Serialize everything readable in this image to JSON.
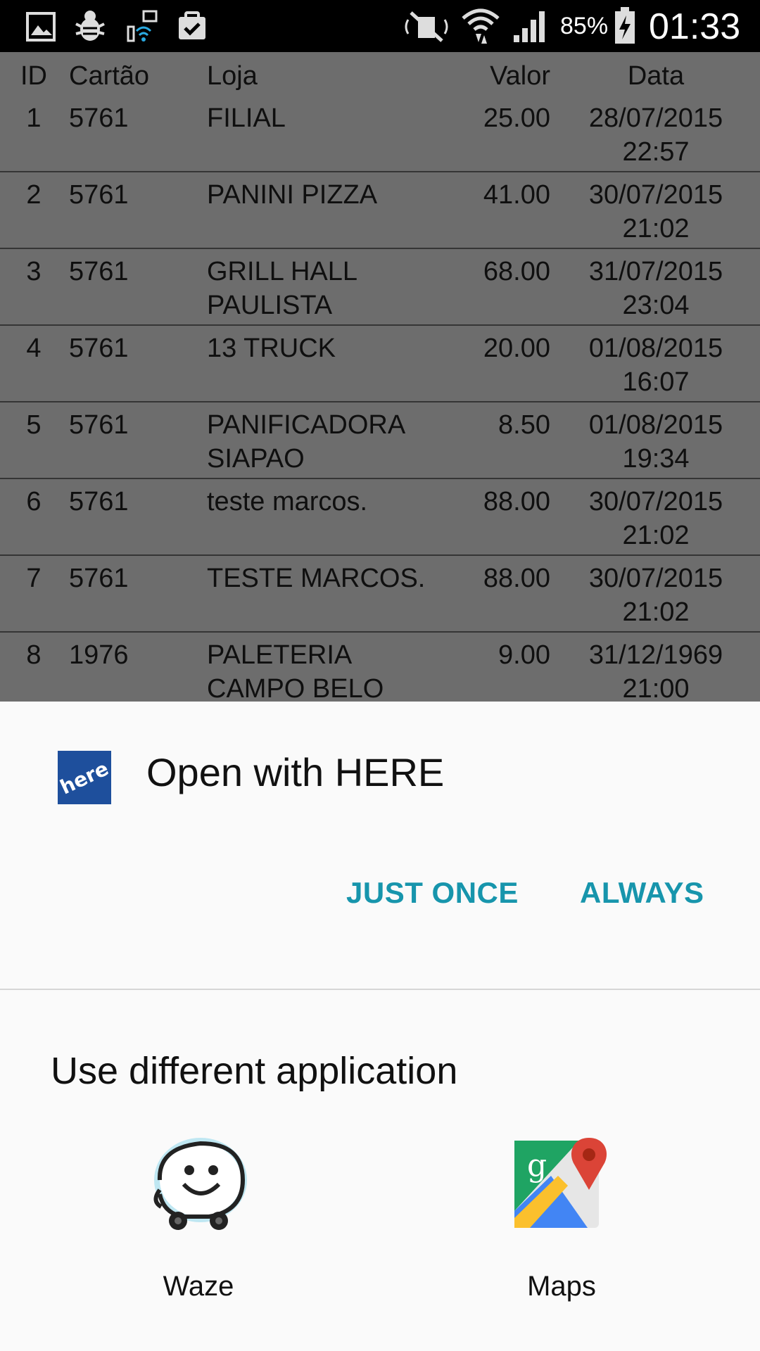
{
  "status_bar": {
    "battery": "85%",
    "clock": "01:33",
    "icons": [
      "gallery-icon",
      "debug-bug-icon",
      "wifi-transfer-icon",
      "clipboard-check-icon",
      "mute-icon",
      "wifi-icon",
      "signal-icon",
      "battery-charging-icon"
    ]
  },
  "table": {
    "headers": {
      "id": "ID",
      "card": "Cartão",
      "store": "Loja",
      "value": "Valor",
      "date": "Data"
    },
    "rows": [
      {
        "id": "1",
        "card": "5761",
        "store": "FILIAL",
        "value": "25.00",
        "date": "28/07/2015 22:57"
      },
      {
        "id": "2",
        "card": "5761",
        "store": "PANINI PIZZA",
        "value": "41.00",
        "date": "30/07/2015 21:02"
      },
      {
        "id": "3",
        "card": "5761",
        "store": "GRILL HALL PAULISTA",
        "value": "68.00",
        "date": "31/07/2015 23:04"
      },
      {
        "id": "4",
        "card": "5761",
        "store": "13 TRUCK",
        "value": "20.00",
        "date": "01/08/2015 16:07"
      },
      {
        "id": "5",
        "card": "5761",
        "store": "PANIFICADORA SIAPAO",
        "value": "8.50",
        "date": "01/08/2015 19:34"
      },
      {
        "id": "6",
        "card": "5761",
        "store": "teste marcos.",
        "value": "88.00",
        "date": "30/07/2015 21:02"
      },
      {
        "id": "7",
        "card": "5761",
        "store": "TESTE MARCOS.",
        "value": "88.00",
        "date": "30/07/2015 21:02"
      },
      {
        "id": "8",
        "card": "1976",
        "store": "PALETERIA CAMPO BELO",
        "value": "9.00",
        "date": "31/12/1969 21:00"
      }
    ]
  },
  "dialog": {
    "app_icon_text": "here",
    "title": "Open with HERE",
    "just_once_label": "JUST ONCE",
    "always_label": "ALWAYS",
    "section_title": "Use different application",
    "apps": [
      {
        "label": "Waze",
        "icon": "waze-icon"
      },
      {
        "label": "Maps",
        "icon": "google-maps-icon"
      }
    ]
  },
  "colors": {
    "accent": "#1795ac",
    "here_blue": "#1e4f9c"
  }
}
